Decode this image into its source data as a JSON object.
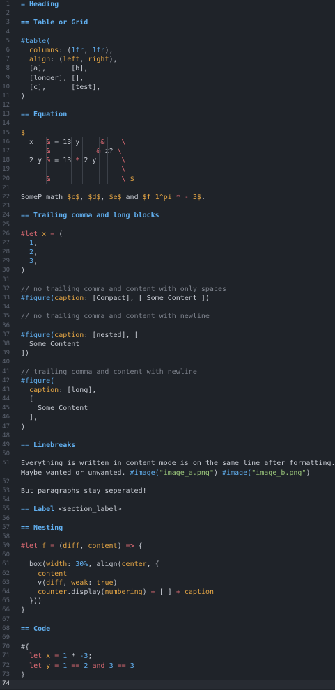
{
  "editor": {
    "current_line": 74,
    "lines": [
      {
        "n": 1,
        "tokens": [
          [
            "= Heading",
            "t-head"
          ]
        ]
      },
      {
        "n": 2,
        "tokens": []
      },
      {
        "n": 3,
        "tokens": [
          [
            "== Table or Grid",
            "t-head"
          ]
        ]
      },
      {
        "n": 4,
        "tokens": []
      },
      {
        "n": 5,
        "tokens": [
          [
            "#table(",
            "t-func"
          ]
        ]
      },
      {
        "n": 6,
        "tokens": [
          [
            "  ",
            "t-def"
          ],
          [
            "columns",
            "t-key"
          ],
          [
            ": (",
            "t-def"
          ],
          [
            "1fr",
            "t-num"
          ],
          [
            ", ",
            "t-def"
          ],
          [
            "1fr",
            "t-num"
          ],
          [
            "),",
            "t-def"
          ]
        ]
      },
      {
        "n": 7,
        "tokens": [
          [
            "  ",
            "t-def"
          ],
          [
            "align",
            "t-key"
          ],
          [
            ": (",
            "t-def"
          ],
          [
            "left",
            "t-key"
          ],
          [
            ", ",
            "t-def"
          ],
          [
            "right",
            "t-key"
          ],
          [
            "),",
            "t-def"
          ]
        ]
      },
      {
        "n": 8,
        "tokens": [
          [
            "  [a],      [b],",
            "t-def"
          ]
        ]
      },
      {
        "n": 9,
        "tokens": [
          [
            "  [longer], [],",
            "t-def"
          ]
        ]
      },
      {
        "n": 10,
        "tokens": [
          [
            "  [c],      [test],",
            "t-def"
          ]
        ]
      },
      {
        "n": 11,
        "tokens": [
          [
            ")",
            "t-def"
          ]
        ]
      },
      {
        "n": 12,
        "tokens": []
      },
      {
        "n": 13,
        "tokens": [
          [
            "== Equation",
            "t-head"
          ]
        ]
      },
      {
        "n": 14,
        "tokens": []
      },
      {
        "n": 15,
        "tokens": [
          [
            "$",
            "t-fn2"
          ]
        ]
      },
      {
        "n": 16,
        "tokens": [
          [
            "  x   ",
            "t-def"
          ],
          [
            "&",
            "t-red"
          ],
          [
            " = 13 y     ",
            "t-def"
          ],
          [
            "&",
            "t-red"
          ],
          [
            "    ",
            "t-def"
          ],
          [
            "\\",
            "t-red"
          ]
        ]
      },
      {
        "n": 17,
        "tokens": [
          [
            "      ",
            "t-def"
          ],
          [
            "&",
            "t-red"
          ],
          [
            "           ",
            "t-def"
          ],
          [
            "&",
            "t-red"
          ],
          [
            " z? ",
            "t-def"
          ],
          [
            "\\",
            "t-red"
          ]
        ]
      },
      {
        "n": 18,
        "tokens": [
          [
            "  2 y ",
            "t-def"
          ],
          [
            "&",
            "t-red"
          ],
          [
            " = 13 ",
            "t-def"
          ],
          [
            "*",
            "t-red"
          ],
          [
            " 2 y      ",
            "t-def"
          ],
          [
            "\\",
            "t-red"
          ]
        ]
      },
      {
        "n": 19,
        "tokens": [
          [
            "                        ",
            "t-def"
          ],
          [
            "\\",
            "t-red"
          ]
        ]
      },
      {
        "n": 20,
        "tokens": [
          [
            "      ",
            "t-def"
          ],
          [
            "&",
            "t-red"
          ],
          [
            "                 ",
            "t-def"
          ],
          [
            "\\",
            "t-red"
          ],
          [
            " $",
            "t-fn2"
          ]
        ]
      },
      {
        "n": 21,
        "tokens": []
      },
      {
        "n": 22,
        "tokens": [
          [
            "SomeP math ",
            "t-def"
          ],
          [
            "$c$",
            "t-mth"
          ],
          [
            ", ",
            "t-def"
          ],
          [
            "$d$",
            "t-mth"
          ],
          [
            ", ",
            "t-def"
          ],
          [
            "$e$",
            "t-mth"
          ],
          [
            " and ",
            "t-def"
          ],
          [
            "$f_1^pi ",
            "t-mth"
          ],
          [
            "*",
            "t-red"
          ],
          [
            " ",
            "t-def"
          ],
          [
            "-",
            "t-red"
          ],
          [
            " 3$",
            "t-mth"
          ],
          [
            ".",
            "t-def"
          ]
        ]
      },
      {
        "n": 23,
        "tokens": []
      },
      {
        "n": 24,
        "tokens": [
          [
            "== Trailing comma and long blocks",
            "t-head"
          ]
        ]
      },
      {
        "n": 25,
        "tokens": []
      },
      {
        "n": 26,
        "tokens": [
          [
            "#let",
            "t-red"
          ],
          [
            " ",
            "t-def"
          ],
          [
            "x",
            "t-fn2"
          ],
          [
            " ",
            "t-def"
          ],
          [
            "=",
            "t-red"
          ],
          [
            " (",
            "t-def"
          ]
        ]
      },
      {
        "n": 27,
        "tokens": [
          [
            "  ",
            "t-def"
          ],
          [
            "1",
            "t-num"
          ],
          [
            ",",
            "t-def"
          ]
        ]
      },
      {
        "n": 28,
        "tokens": [
          [
            "  ",
            "t-def"
          ],
          [
            "2",
            "t-num"
          ],
          [
            ",",
            "t-def"
          ]
        ]
      },
      {
        "n": 29,
        "tokens": [
          [
            "  ",
            "t-def"
          ],
          [
            "3",
            "t-num"
          ],
          [
            ",",
            "t-def"
          ]
        ]
      },
      {
        "n": 30,
        "tokens": [
          [
            ")",
            "t-def"
          ]
        ]
      },
      {
        "n": 31,
        "tokens": []
      },
      {
        "n": 32,
        "tokens": [
          [
            "// no trailing comma and content with only spaces",
            "t-com"
          ]
        ]
      },
      {
        "n": 33,
        "tokens": [
          [
            "#figure(",
            "t-func"
          ],
          [
            "caption",
            "t-key"
          ],
          [
            ": [Compact], [ Some Content ])",
            "t-def"
          ]
        ]
      },
      {
        "n": 34,
        "tokens": []
      },
      {
        "n": 35,
        "tokens": [
          [
            "// no trailing comma and content with newline",
            "t-com"
          ]
        ]
      },
      {
        "n": 36,
        "tokens": []
      },
      {
        "n": 37,
        "tokens": [
          [
            "#figure(",
            "t-func"
          ],
          [
            "caption",
            "t-key"
          ],
          [
            ": [nested], [",
            "t-def"
          ]
        ]
      },
      {
        "n": 38,
        "tokens": [
          [
            "  Some Content",
            "t-def"
          ]
        ]
      },
      {
        "n": 39,
        "tokens": [
          [
            "])",
            "t-def"
          ]
        ]
      },
      {
        "n": 40,
        "tokens": []
      },
      {
        "n": 41,
        "tokens": [
          [
            "// trailing comma and content with newline",
            "t-com"
          ]
        ]
      },
      {
        "n": 42,
        "tokens": [
          [
            "#figure(",
            "t-func"
          ]
        ]
      },
      {
        "n": 43,
        "tokens": [
          [
            "  ",
            "t-def"
          ],
          [
            "caption",
            "t-key"
          ],
          [
            ": [long],",
            "t-def"
          ]
        ]
      },
      {
        "n": 44,
        "tokens": [
          [
            "  [",
            "t-def"
          ]
        ]
      },
      {
        "n": 45,
        "tokens": [
          [
            "    Some Content",
            "t-def"
          ]
        ]
      },
      {
        "n": 46,
        "tokens": [
          [
            "  ],",
            "t-def"
          ]
        ]
      },
      {
        "n": 47,
        "tokens": [
          [
            ")",
            "t-def"
          ]
        ]
      },
      {
        "n": 48,
        "tokens": []
      },
      {
        "n": 49,
        "tokens": [
          [
            "== Linebreaks",
            "t-head"
          ]
        ]
      },
      {
        "n": 50,
        "tokens": []
      },
      {
        "n": 51,
        "wrap": true,
        "tokens": [
          [
            "Everything is written in content mode is on the same line after formatting.\nMaybe wanted or unwanted. ",
            "t-def"
          ],
          [
            "#image(",
            "t-func"
          ],
          [
            "\"image_a.png\"",
            "t-str"
          ],
          [
            ") ",
            "t-def"
          ],
          [
            "#image(",
            "t-func"
          ],
          [
            "\"image_b.png\"",
            "t-str"
          ],
          [
            ")",
            "t-def"
          ]
        ]
      },
      {
        "n": 52,
        "tokens": []
      },
      {
        "n": 53,
        "tokens": [
          [
            "But paragraphs stay seperated!",
            "t-def"
          ]
        ]
      },
      {
        "n": 54,
        "tokens": []
      },
      {
        "n": 55,
        "tokens": [
          [
            "== Label ",
            "t-head"
          ],
          [
            "<section_label>",
            "t-def"
          ]
        ]
      },
      {
        "n": 56,
        "tokens": []
      },
      {
        "n": 57,
        "tokens": [
          [
            "== Nesting",
            "t-head"
          ]
        ]
      },
      {
        "n": 58,
        "tokens": []
      },
      {
        "n": 59,
        "tokens": [
          [
            "#let",
            "t-red"
          ],
          [
            " ",
            "t-def"
          ],
          [
            "f",
            "t-fn2"
          ],
          [
            " ",
            "t-def"
          ],
          [
            "=",
            "t-red"
          ],
          [
            " (",
            "t-def"
          ],
          [
            "diff",
            "t-fn2"
          ],
          [
            ", ",
            "t-def"
          ],
          [
            "content",
            "t-fn2"
          ],
          [
            ") ",
            "t-def"
          ],
          [
            "=>",
            "t-red"
          ],
          [
            " {",
            "t-def"
          ]
        ]
      },
      {
        "n": 60,
        "tokens": []
      },
      {
        "n": 61,
        "tokens": [
          [
            "  box(",
            "t-def"
          ],
          [
            "width",
            "t-key"
          ],
          [
            ": ",
            "t-def"
          ],
          [
            "30%",
            "t-num"
          ],
          [
            ", ",
            "t-def"
          ],
          [
            "align",
            "t-def"
          ],
          [
            "(",
            "t-def"
          ],
          [
            "center",
            "t-key"
          ],
          [
            ", {",
            "t-def"
          ]
        ]
      },
      {
        "n": 62,
        "tokens": [
          [
            "    ",
            "t-def"
          ],
          [
            "content",
            "t-key"
          ]
        ]
      },
      {
        "n": 63,
        "tokens": [
          [
            "    v(",
            "t-def"
          ],
          [
            "diff",
            "t-key"
          ],
          [
            ", ",
            "t-def"
          ],
          [
            "weak",
            "t-key"
          ],
          [
            ": ",
            "t-def"
          ],
          [
            "true",
            "t-key"
          ],
          [
            ")",
            "t-def"
          ]
        ]
      },
      {
        "n": 64,
        "tokens": [
          [
            "    ",
            "t-def"
          ],
          [
            "counter",
            "t-key"
          ],
          [
            ".display(",
            "t-def"
          ],
          [
            "numbering",
            "t-key"
          ],
          [
            ") ",
            "t-def"
          ],
          [
            "+",
            "t-red"
          ],
          [
            " [ ] ",
            "t-def"
          ],
          [
            "+",
            "t-red"
          ],
          [
            " ",
            "t-def"
          ],
          [
            "caption",
            "t-key"
          ]
        ]
      },
      {
        "n": 65,
        "tokens": [
          [
            "  }))",
            "t-def"
          ]
        ]
      },
      {
        "n": 66,
        "tokens": [
          [
            "}",
            "t-def"
          ]
        ]
      },
      {
        "n": 67,
        "tokens": []
      },
      {
        "n": 68,
        "tokens": [
          [
            "== Code",
            "t-head"
          ]
        ]
      },
      {
        "n": 69,
        "tokens": []
      },
      {
        "n": 70,
        "tokens": [
          [
            "#{",
            "t-def"
          ]
        ]
      },
      {
        "n": 71,
        "tokens": [
          [
            "  ",
            "t-def"
          ],
          [
            "let",
            "t-red"
          ],
          [
            " ",
            "t-def"
          ],
          [
            "x",
            "t-fn2"
          ],
          [
            " ",
            "t-def"
          ],
          [
            "=",
            "t-red"
          ],
          [
            " ",
            "t-def"
          ],
          [
            "1",
            "t-num"
          ],
          [
            " * ",
            "t-def"
          ],
          [
            "-3",
            "t-num"
          ],
          [
            ";",
            "t-def"
          ]
        ]
      },
      {
        "n": 72,
        "tokens": [
          [
            "  ",
            "t-def"
          ],
          [
            "let",
            "t-red"
          ],
          [
            " ",
            "t-def"
          ],
          [
            "y",
            "t-fn2"
          ],
          [
            " ",
            "t-def"
          ],
          [
            "=",
            "t-red"
          ],
          [
            " ",
            "t-def"
          ],
          [
            "1",
            "t-num"
          ],
          [
            " ",
            "t-def"
          ],
          [
            "==",
            "t-red"
          ],
          [
            " ",
            "t-def"
          ],
          [
            "2",
            "t-num"
          ],
          [
            " ",
            "t-def"
          ],
          [
            "and",
            "t-red"
          ],
          [
            " ",
            "t-def"
          ],
          [
            "3",
            "t-num"
          ],
          [
            " ",
            "t-def"
          ],
          [
            "==",
            "t-red"
          ],
          [
            " ",
            "t-def"
          ],
          [
            "3",
            "t-num"
          ]
        ]
      },
      {
        "n": 73,
        "tokens": [
          [
            "}",
            "t-def"
          ]
        ]
      },
      {
        "n": 74,
        "tokens": []
      }
    ]
  }
}
